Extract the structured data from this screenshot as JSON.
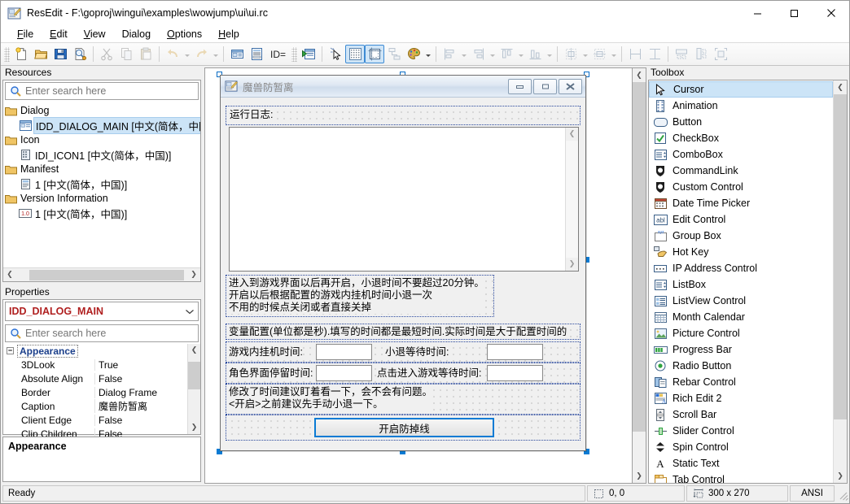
{
  "window": {
    "title": "ResEdit - F:\\goproj\\wingui\\examples\\wowjump\\ui\\ui.rc",
    "app_icon": "resedit-icon",
    "minimize_label": "Minimize",
    "maximize_label": "Maximize",
    "close_label": "Close"
  },
  "menu": [
    {
      "label": "File",
      "accel": "F"
    },
    {
      "label": "Edit",
      "accel": "E"
    },
    {
      "label": "View",
      "accel": "V"
    },
    {
      "label": "Dialog",
      "accel": "D"
    },
    {
      "label": "Options",
      "accel": "O"
    },
    {
      "label": "Help",
      "accel": "H"
    }
  ],
  "toolbar": {
    "id_label": "ID=",
    "buttons": [
      {
        "name": "new-file-button",
        "icon": "new-document-icon",
        "enabled": true
      },
      {
        "name": "open-file-button",
        "icon": "open-folder-icon",
        "enabled": true
      },
      {
        "name": "save-button",
        "icon": "floppy-save-icon",
        "enabled": true
      },
      {
        "name": "preview-button",
        "icon": "magnifier-page-icon",
        "enabled": true
      },
      {
        "name": "cut-button",
        "icon": "scissors-icon",
        "enabled": false
      },
      {
        "name": "copy-button",
        "icon": "copy-pages-icon",
        "enabled": false
      },
      {
        "name": "paste-button",
        "icon": "clipboard-icon",
        "enabled": false
      },
      {
        "name": "undo-button",
        "icon": "undo-arrow-icon",
        "enabled": false
      },
      {
        "name": "redo-button",
        "icon": "redo-arrow-icon",
        "enabled": false
      },
      {
        "name": "resource-properties-button",
        "icon": "dialog-properties-icon",
        "enabled": true
      },
      {
        "name": "resource-script-button",
        "icon": "script-lines-icon",
        "enabled": true
      },
      {
        "name": "run-test-dialog-button",
        "icon": "run-play-icon",
        "enabled": true
      },
      {
        "name": "select-pointer-button",
        "icon": "arrow-pointer-icon",
        "enabled": true
      },
      {
        "name": "show-grid-button",
        "icon": "grid-dots-icon",
        "enabled": true,
        "selected": true
      },
      {
        "name": "show-guides-button",
        "icon": "dialog-bounds-icon",
        "enabled": true,
        "selected": true
      },
      {
        "name": "tab-order-button",
        "icon": "tab-order-icon",
        "enabled": true
      },
      {
        "name": "palette-button",
        "icon": "color-palette-icon",
        "enabled": true
      },
      {
        "name": "align-left-button",
        "icon": "align-left-icon",
        "enabled": false
      },
      {
        "name": "align-right-button",
        "icon": "align-right-icon",
        "enabled": false
      },
      {
        "name": "align-top-button",
        "icon": "align-top-icon",
        "enabled": false
      },
      {
        "name": "align-bottom-button",
        "icon": "align-bottom-icon",
        "enabled": false
      },
      {
        "name": "center-horizontal-button",
        "icon": "center-horizontal-icon",
        "enabled": false
      },
      {
        "name": "center-vertical-button",
        "icon": "center-vertical-icon",
        "enabled": false
      },
      {
        "name": "same-width-button",
        "icon": "same-width-icon",
        "enabled": false
      },
      {
        "name": "same-height-button",
        "icon": "same-height-icon",
        "enabled": false
      },
      {
        "name": "space-across-button",
        "icon": "space-across-icon",
        "enabled": false
      },
      {
        "name": "space-down-button",
        "icon": "space-down-icon",
        "enabled": false
      },
      {
        "name": "size-to-content-button",
        "icon": "size-to-content-icon",
        "enabled": false
      }
    ]
  },
  "resources": {
    "title": "Resources",
    "search_placeholder": "Enter search here",
    "search_value": "",
    "tree": [
      {
        "label": "Dialog",
        "icon": "folder-icon",
        "level": 0,
        "selected": false
      },
      {
        "label": "IDD_DIALOG_MAIN [中文(简体，中国)]",
        "icon": "dialog-resource-icon",
        "level": 1,
        "selected": true
      },
      {
        "label": "Icon",
        "icon": "folder-icon",
        "level": 0,
        "selected": false
      },
      {
        "label": "IDI_ICON1 [中文(简体，中国)]",
        "icon": "icon-resource-icon",
        "level": 1,
        "selected": false
      },
      {
        "label": "Manifest",
        "icon": "folder-icon",
        "level": 0,
        "selected": false
      },
      {
        "label": "1 [中文(简体，中国)]",
        "icon": "manifest-resource-icon",
        "level": 1,
        "selected": false
      },
      {
        "label": "Version Information",
        "icon": "folder-icon",
        "level": 0,
        "selected": false
      },
      {
        "label": "1 [中文(简体，中国)]",
        "icon": "version-resource-icon",
        "level": 1,
        "selected": false
      }
    ]
  },
  "properties": {
    "title": "Properties",
    "selected_object": "IDD_DIALOG_MAIN",
    "search_placeholder": "Enter search here",
    "search_value": "",
    "group": "Appearance",
    "rows": [
      {
        "key": "3DLook",
        "value": "True"
      },
      {
        "key": "Absolute Align",
        "value": "False"
      },
      {
        "key": "Border",
        "value": "Dialog Frame"
      },
      {
        "key": "Caption",
        "value": "魔兽防暂离"
      },
      {
        "key": "Client Edge",
        "value": "False"
      },
      {
        "key": "Clip Children",
        "value": "False"
      }
    ],
    "description": "Appearance"
  },
  "dialog_preview": {
    "caption": "魔兽防暂离",
    "icon": "resedit-icon",
    "minimize_label": "—",
    "maximize_label": "□",
    "close_label": "✕",
    "log_label": "运行日志:",
    "log_value": "",
    "info_lines": [
      "进入到游戏界面以后再开启，小退时间不要超过20分钟。",
      "开启以后根据配置的游戏内挂机时间小退一次",
      "不用的时候点关闭或者直接关掉"
    ],
    "config_note": "变量配置(单位都是秒).填写的时间都是最短时间.实际时间是大于配置时间的",
    "fields": [
      {
        "label": "游戏内挂机时间:",
        "value": ""
      },
      {
        "label": "小退等待时间:",
        "value": ""
      },
      {
        "label": "角色界面停留时间:",
        "value": ""
      },
      {
        "label": "点击进入游戏等待时间:",
        "value": ""
      }
    ],
    "warn_lines": [
      "修改了时间建议盯着看一下，会不会有问题。",
      "<开启>之前建议先手动小退一下。"
    ],
    "action_button": "开启防掉线"
  },
  "toolbox": {
    "title": "Toolbox",
    "items": [
      {
        "label": "Cursor",
        "icon": "arrow-pointer-icon",
        "selected": true
      },
      {
        "label": "Animation",
        "icon": "film-strip-icon",
        "selected": false
      },
      {
        "label": "Button",
        "icon": "button-icon",
        "selected": false
      },
      {
        "label": "CheckBox",
        "icon": "checkbox-icon",
        "selected": false
      },
      {
        "label": "ComboBox",
        "icon": "combobox-icon",
        "selected": false
      },
      {
        "label": "CommandLink",
        "icon": "shield-link-icon",
        "selected": false
      },
      {
        "label": "Custom Control",
        "icon": "shield-link-icon",
        "selected": false
      },
      {
        "label": "Date Time Picker",
        "icon": "calendar-clock-icon",
        "selected": false
      },
      {
        "label": "Edit Control",
        "icon": "edit-abl-icon",
        "selected": false
      },
      {
        "label": "Group Box",
        "icon": "groupbox-icon",
        "selected": false
      },
      {
        "label": "Hot Key",
        "icon": "hotkey-hand-icon",
        "selected": false
      },
      {
        "label": "IP Address Control",
        "icon": "ip-address-icon",
        "selected": false
      },
      {
        "label": "ListBox",
        "icon": "listbox-icon",
        "selected": false
      },
      {
        "label": "ListView Control",
        "icon": "listview-icon",
        "selected": false
      },
      {
        "label": "Month Calendar",
        "icon": "month-calendar-icon",
        "selected": false
      },
      {
        "label": "Picture Control",
        "icon": "picture-icon",
        "selected": false
      },
      {
        "label": "Progress Bar",
        "icon": "progressbar-icon",
        "selected": false
      },
      {
        "label": "Radio Button",
        "icon": "radio-button-icon",
        "selected": false
      },
      {
        "label": "Rebar Control",
        "icon": "rebar-icon",
        "selected": false
      },
      {
        "label": "Rich Edit 2",
        "icon": "rich-edit-icon",
        "selected": false
      },
      {
        "label": "Scroll Bar",
        "icon": "scrollbar-icon",
        "selected": false
      },
      {
        "label": "Slider Control",
        "icon": "slider-icon",
        "selected": false
      },
      {
        "label": "Spin Control",
        "icon": "spin-icon",
        "selected": false
      },
      {
        "label": "Static Text",
        "icon": "static-text-a-icon",
        "selected": false
      },
      {
        "label": "Tab Control",
        "icon": "tab-control-icon",
        "selected": false
      }
    ]
  },
  "statusbar": {
    "message": "Ready",
    "position": "0, 0",
    "size": "300 x 270",
    "encoding": "ANSI",
    "position_icon": "position-icon",
    "size_icon": "size-icon"
  }
}
